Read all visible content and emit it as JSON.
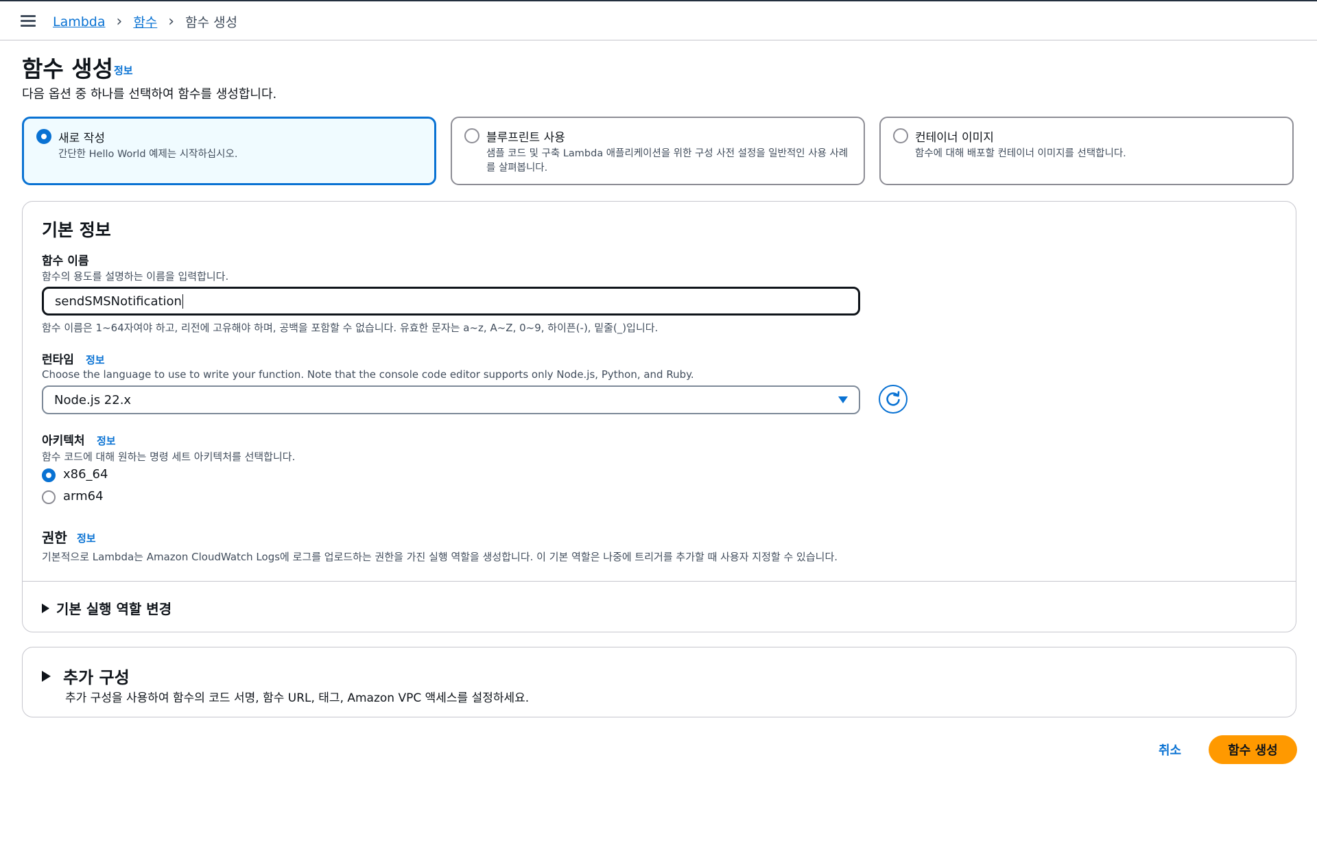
{
  "breadcrumb": {
    "items": [
      "Lambda",
      "함수"
    ],
    "current": "함수 생성"
  },
  "page": {
    "title": "함수 생성",
    "info_link": "정보",
    "subtitle": "다음 옵션 중 하나를 선택하여 함수를 생성합니다."
  },
  "options": [
    {
      "title": "새로 작성",
      "desc": "간단한 Hello World 예제는 시작하십시오.",
      "selected": true
    },
    {
      "title": "블루프린트 사용",
      "desc": "샘플 코드 및 구축 Lambda 애플리케이션을 위한 구성 사전 설정을 일반적인 사용 사례를 살펴봅니다.",
      "selected": false
    },
    {
      "title": "컨테이너 이미지",
      "desc": "함수에 대해 배포할 컨테이너 이미지를 선택합니다.",
      "selected": false
    }
  ],
  "basic": {
    "title": "기본 정보",
    "function_name": {
      "label": "함수 이름",
      "desc": "함수의 용도를 설명하는 이름을 입력합니다.",
      "value": "sendSMSNotification",
      "constraint": "함수 이름은 1~64자여야 하고, 리전에 고유해야 하며, 공백을 포함할 수 없습니다. 유효한 문자는 a~z, A~Z, 0~9, 하이픈(-), 밑줄(_)입니다."
    },
    "runtime": {
      "label": "런타임",
      "info": "정보",
      "desc": "Choose the language to use to write your function. Note that the console code editor supports only Node.js, Python, and Ruby.",
      "value": "Node.js 22.x"
    },
    "architecture": {
      "label": "아키텍처",
      "info": "정보",
      "desc": "함수 코드에 대해 원하는 명령 세트 아키텍처를 선택합니다.",
      "options": [
        "x86_64",
        "arm64"
      ],
      "selected": "x86_64"
    },
    "permissions": {
      "label": "권한",
      "info": "정보",
      "desc": "기본적으로 Lambda는 Amazon CloudWatch Logs에 로그를 업로드하는 권한을 가진 실행 역할을 생성합니다. 이 기본 역할은 나중에 트리거를 추가할 때 사용자 지정할 수 있습니다."
    },
    "change_role": "기본 실행 역할 변경"
  },
  "additional": {
    "title": "추가 구성",
    "desc": "추가 구성을 사용하여 함수의 코드 서명, 함수 URL, 태그, Amazon VPC 액세스를 설정하세요."
  },
  "actions": {
    "cancel": "취소",
    "create": "함수 생성"
  },
  "colors": {
    "accent": "#0972d3",
    "primary_button": "#ff9900",
    "selected_tile_bg": "#f0fbff"
  }
}
